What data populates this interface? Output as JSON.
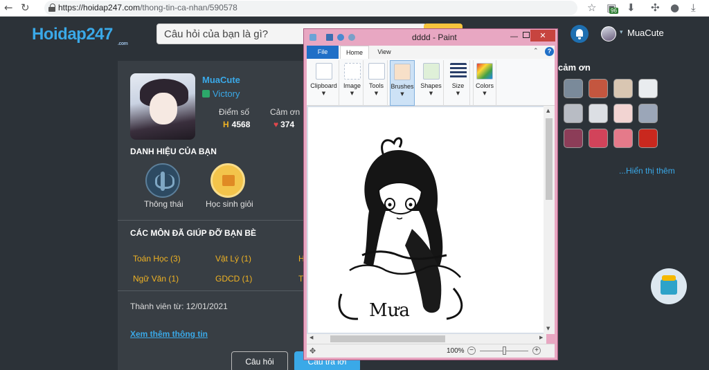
{
  "browser": {
    "url_host": "https://hoidap247.com",
    "url_path": "/thong-tin-ca-nhan/590578",
    "extension_badge": "96",
    "icons": [
      "back-icon",
      "reload-icon",
      "lock-icon",
      "star-icon",
      "download-icon",
      "puzzle-icon",
      "account-icon"
    ]
  },
  "site": {
    "logo_main": "Hoidap247",
    "logo_sub": ".com",
    "search_placeholder": "Câu hỏi của bạn là gì?",
    "user_name": "MuaCute",
    "colors": {
      "brand": "#3aa9e8",
      "accent": "#f6c43c",
      "background": "#2c3238"
    }
  },
  "profile": {
    "name": "MuaCute",
    "rank": "Victory",
    "score_label": "Điểm số",
    "score_value": "4568",
    "thanks_label": "Cảm ơn",
    "thanks_value": "374",
    "titles_heading": "DANH HIỆU CỦA BẠN",
    "badges": [
      {
        "label": "Thông thái",
        "icon": "wheat-icon"
      },
      {
        "label": "Học sinh giỏi",
        "icon": "medal-icon"
      }
    ],
    "subjects_heading": "CÁC MÔN ĐÃ GIÚP ĐỠ BẠN BÈ",
    "subjects": [
      "Toán Học (3)",
      "Vật Lý (1)",
      "H",
      "Ngữ Văn (1)",
      "GDCD (1)",
      "T"
    ],
    "member_since": "Thành viên từ: 12/01/2021",
    "see_more": "Xem thêm thông tin",
    "btn_questions": "Câu hỏi",
    "btn_answers": "Câu trả lời"
  },
  "thanks_panel": {
    "title": "cảm ơn",
    "more_link": "...Hiển thị thêm",
    "avatar_colors": [
      "#7a8a9a",
      "#c4563f",
      "#d9c6b2",
      "#e9ecef",
      "#b8bcc4",
      "#dcdfe4",
      "#f2d4d2",
      "#9ba6b8",
      "#8c3d58",
      "#d2435a",
      "#e57a8a",
      "#c9281e"
    ]
  },
  "paint": {
    "title": "dddd - Paint",
    "close": "✕",
    "minimize": "—",
    "tabs": {
      "file": "File",
      "home": "Home",
      "view": "View"
    },
    "help": "?",
    "groups": [
      "Clipboard",
      "Image",
      "Tools",
      "Brushes",
      "Shapes",
      "Size",
      "Colors"
    ],
    "drawing_text": "Mưa",
    "zoom": "100%"
  }
}
